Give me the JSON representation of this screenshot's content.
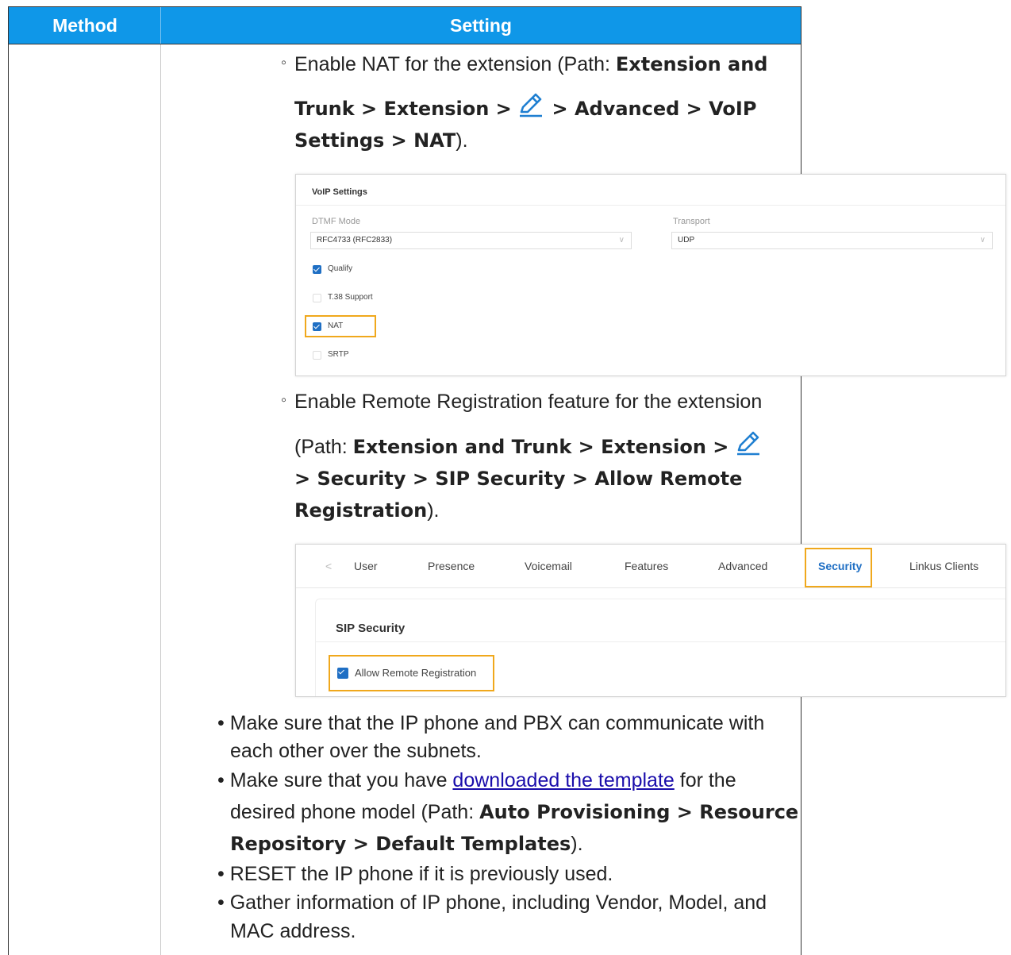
{
  "table": {
    "col_method": "Method",
    "col_setting": "Setting"
  },
  "nat_step": {
    "prefix": "Enable NAT for the extension (Path: ",
    "path_line1": "Extension and",
    "path_line2a": "Trunk > Extension > ",
    "path_line2b": " > Advanced > VoIP",
    "path_line3": "Settings > NAT",
    "suffix": ")."
  },
  "voip_card": {
    "title": "VoIP Settings",
    "dtmf_label": "DTMF Mode",
    "dtmf_value": "RFC4733 (RFC2833)",
    "transport_label": "Transport",
    "transport_value": "UDP",
    "options": [
      {
        "label": "Qualify",
        "checked": true
      },
      {
        "label": "T.38 Support",
        "checked": false
      },
      {
        "label": "NAT",
        "checked": true
      },
      {
        "label": "SRTP",
        "checked": false
      }
    ]
  },
  "remote_step": {
    "line1": "Enable Remote Registration feature for the extension",
    "line2_prefix": "(Path: ",
    "line2_bold": "Extension and Trunk > Extension > ",
    "line3": "> Security > SIP Security > Allow Remote",
    "line4": "Registration",
    "suffix": ")."
  },
  "security_card": {
    "back_glyph": "<",
    "tabs": [
      "User",
      "Presence",
      "Voicemail",
      "Features",
      "Advanced",
      "Security",
      "Linkus Clients"
    ],
    "active_tab": "Security",
    "section_title": "SIP Security",
    "checkbox_label": "Allow Remote Registration"
  },
  "bullets": {
    "b1_line1": "Make sure that the IP phone and PBX can communicate with",
    "b1_line2": "each other over the subnets.",
    "b2_pre": "Make sure that you have ",
    "b2_link": "downloaded the template",
    "b2_post": " for the",
    "b2_line2_pre": "desired phone model (Path: ",
    "b2_line2_bold": "Auto Provisioning > Resource",
    "b2_line3_bold": "Repository > Default Templates",
    "b2_line3_post": ").",
    "b3": "RESET the IP phone if it is previously used.",
    "b4_line1": "Gather information of IP phone, including Vendor, Model, and",
    "b4_line2": "MAC address."
  },
  "colors": {
    "header_bg": "#0f97e8",
    "highlight": "#f0a81c",
    "checkbox": "#1f6fc4",
    "active_tab": "#1f6fc4"
  }
}
